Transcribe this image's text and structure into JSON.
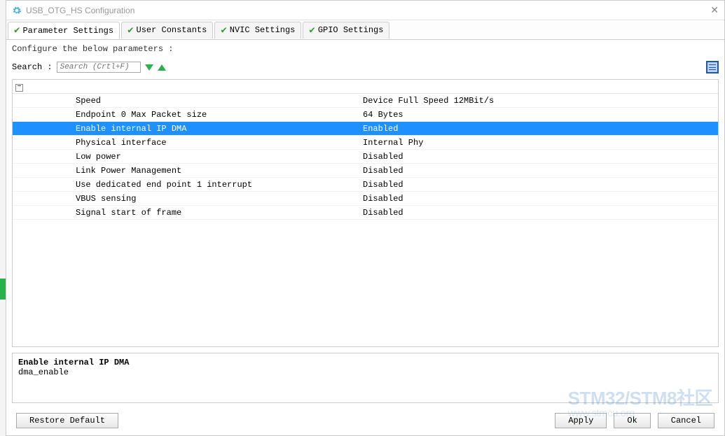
{
  "window": {
    "title": "USB_OTG_HS Configuration"
  },
  "tabs": [
    {
      "label": "Parameter Settings",
      "active": true
    },
    {
      "label": "User Constants",
      "active": false
    },
    {
      "label": "NVIC Settings",
      "active": false
    },
    {
      "label": "GPIO Settings",
      "active": false
    }
  ],
  "subtitle": "Configure the below parameters :",
  "search": {
    "label": "Search :",
    "placeholder": "Search (Crtl+F)"
  },
  "params": [
    {
      "name": "Speed",
      "value": "Device Full Speed 12MBit/s",
      "selected": false
    },
    {
      "name": "Endpoint 0 Max Packet size",
      "value": "64 Bytes",
      "selected": false
    },
    {
      "name": "Enable internal IP DMA",
      "value": "Enabled",
      "selected": true
    },
    {
      "name": "Physical interface",
      "value": "Internal Phy",
      "selected": false
    },
    {
      "name": "Low power",
      "value": "Disabled",
      "selected": false
    },
    {
      "name": "Link Power Management",
      "value": "Disabled",
      "selected": false
    },
    {
      "name": "Use dedicated end point 1 interrupt",
      "value": "Disabled",
      "selected": false
    },
    {
      "name": "VBUS sensing",
      "value": "Disabled",
      "selected": false
    },
    {
      "name": "Signal start of frame",
      "value": "Disabled",
      "selected": false
    }
  ],
  "description": {
    "title": "Enable internal IP DMA",
    "detail": "dma_enable"
  },
  "buttons": {
    "restore": "Restore Default",
    "apply": "Apply",
    "ok": "Ok",
    "cancel": "Cancel"
  },
  "watermark": {
    "main": "STM32/STM8社区",
    "sub": "www.stmcu.org"
  }
}
